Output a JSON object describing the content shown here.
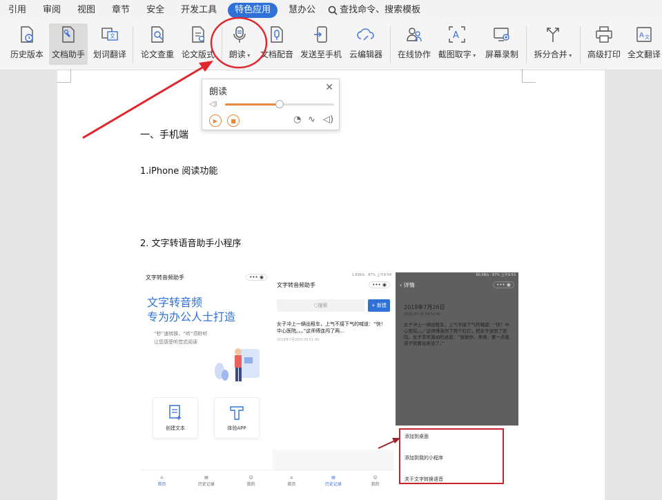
{
  "menubar": {
    "items": [
      "引用",
      "审阅",
      "视图",
      "章节",
      "安全",
      "开发工具",
      "特色应用",
      "慧办公"
    ],
    "active": "特色应用",
    "search_label": "查找命令、搜索模板"
  },
  "ribbon": {
    "buttons": {
      "history": "历史版本",
      "doc_helper": "文档助手",
      "translate_word": "划词翻译",
      "paper_check": "论文查重",
      "paper_format": "论文版式",
      "read_aloud": "朗读",
      "voiceover": "文档配音",
      "send_phone": "发送至手机",
      "cloud_editor": "云编辑器",
      "online_collab": "在线协作",
      "ocr": "截图取字",
      "screen_record": "屏幕录制",
      "split_merge": "拆分合并",
      "adv_print": "高级打印",
      "full_translate": "全文翻译"
    }
  },
  "popup": {
    "title": "朗读",
    "volume_fraction": 0.5
  },
  "document": {
    "h1": "一、手机端",
    "h2": "1.iPhone 阅读功能",
    "h3": "2.  文字转语音助手小程序"
  },
  "phone1": {
    "app_title": "文字转音频助手",
    "slogan1": "文字转音频",
    "slogan2": "专为办公人士打造",
    "sub1": "“秒”速转换，“听”须聆听",
    "sub2": "让您感受听觉式阅读",
    "card1": "创建文本",
    "card2": "体验APP",
    "tabs": [
      "首页",
      "历史记录",
      "我的"
    ]
  },
  "phone2": {
    "status": "1.83K/s · 87% 上午9:54",
    "app_title": "文字转音频助手",
    "search_placeholder": "搜索",
    "new_btn": "+ 新建",
    "item_text": "女子冲上一辆出租车，上气不接下气的喊道：“快！中心医院。。。”这师傅连闯了两…",
    "item_time": "2019年7月26日 09:51:40",
    "tabs": [
      "首页",
      "历史记录",
      "我的"
    ]
  },
  "phone3": {
    "status": "60.0B/s · 87% 上午9:53",
    "header": "详情",
    "date": "2019年7月26日",
    "date_sub": "2019-07-26 09:51:40",
    "body": "女子冲上一辆出租车，上气不接下气的喊道：“快！中心医院。。。”这师傅连闯了两个红灯，把女子送到了医院，女子非常激动的说道：“谢谢你，师傅，要一点我孩子就要出来没了。”",
    "opt1": "添加到桌面",
    "opt2": "添加到我的小程序",
    "opt3": "关于文字转换语音"
  },
  "colors": {
    "accent": "#2f71d6",
    "orange": "#e8883a",
    "red": "#c8232c"
  }
}
